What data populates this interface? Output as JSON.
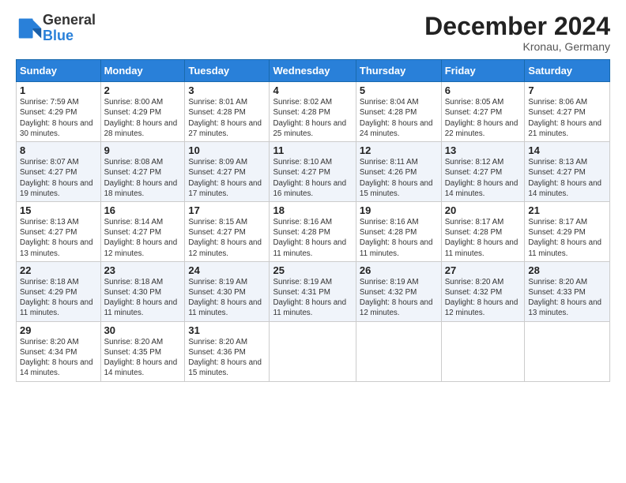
{
  "logo": {
    "general": "General",
    "blue": "Blue"
  },
  "title": {
    "month_year": "December 2024",
    "location": "Kronau, Germany"
  },
  "weekdays": [
    "Sunday",
    "Monday",
    "Tuesday",
    "Wednesday",
    "Thursday",
    "Friday",
    "Saturday"
  ],
  "weeks": [
    [
      {
        "day": "1",
        "sunrise": "7:59 AM",
        "sunset": "4:29 PM",
        "daylight": "8 hours and 30 minutes."
      },
      {
        "day": "2",
        "sunrise": "8:00 AM",
        "sunset": "4:29 PM",
        "daylight": "8 hours and 28 minutes."
      },
      {
        "day": "3",
        "sunrise": "8:01 AM",
        "sunset": "4:28 PM",
        "daylight": "8 hours and 27 minutes."
      },
      {
        "day": "4",
        "sunrise": "8:02 AM",
        "sunset": "4:28 PM",
        "daylight": "8 hours and 25 minutes."
      },
      {
        "day": "5",
        "sunrise": "8:04 AM",
        "sunset": "4:28 PM",
        "daylight": "8 hours and 24 minutes."
      },
      {
        "day": "6",
        "sunrise": "8:05 AM",
        "sunset": "4:27 PM",
        "daylight": "8 hours and 22 minutes."
      },
      {
        "day": "7",
        "sunrise": "8:06 AM",
        "sunset": "4:27 PM",
        "daylight": "8 hours and 21 minutes."
      }
    ],
    [
      {
        "day": "8",
        "sunrise": "8:07 AM",
        "sunset": "4:27 PM",
        "daylight": "8 hours and 19 minutes."
      },
      {
        "day": "9",
        "sunrise": "8:08 AM",
        "sunset": "4:27 PM",
        "daylight": "8 hours and 18 minutes."
      },
      {
        "day": "10",
        "sunrise": "8:09 AM",
        "sunset": "4:27 PM",
        "daylight": "8 hours and 17 minutes."
      },
      {
        "day": "11",
        "sunrise": "8:10 AM",
        "sunset": "4:27 PM",
        "daylight": "8 hours and 16 minutes."
      },
      {
        "day": "12",
        "sunrise": "8:11 AM",
        "sunset": "4:26 PM",
        "daylight": "8 hours and 15 minutes."
      },
      {
        "day": "13",
        "sunrise": "8:12 AM",
        "sunset": "4:27 PM",
        "daylight": "8 hours and 14 minutes."
      },
      {
        "day": "14",
        "sunrise": "8:13 AM",
        "sunset": "4:27 PM",
        "daylight": "8 hours and 14 minutes."
      }
    ],
    [
      {
        "day": "15",
        "sunrise": "8:13 AM",
        "sunset": "4:27 PM",
        "daylight": "8 hours and 13 minutes."
      },
      {
        "day": "16",
        "sunrise": "8:14 AM",
        "sunset": "4:27 PM",
        "daylight": "8 hours and 12 minutes."
      },
      {
        "day": "17",
        "sunrise": "8:15 AM",
        "sunset": "4:27 PM",
        "daylight": "8 hours and 12 minutes."
      },
      {
        "day": "18",
        "sunrise": "8:16 AM",
        "sunset": "4:28 PM",
        "daylight": "8 hours and 11 minutes."
      },
      {
        "day": "19",
        "sunrise": "8:16 AM",
        "sunset": "4:28 PM",
        "daylight": "8 hours and 11 minutes."
      },
      {
        "day": "20",
        "sunrise": "8:17 AM",
        "sunset": "4:28 PM",
        "daylight": "8 hours and 11 minutes."
      },
      {
        "day": "21",
        "sunrise": "8:17 AM",
        "sunset": "4:29 PM",
        "daylight": "8 hours and 11 minutes."
      }
    ],
    [
      {
        "day": "22",
        "sunrise": "8:18 AM",
        "sunset": "4:29 PM",
        "daylight": "8 hours and 11 minutes."
      },
      {
        "day": "23",
        "sunrise": "8:18 AM",
        "sunset": "4:30 PM",
        "daylight": "8 hours and 11 minutes."
      },
      {
        "day": "24",
        "sunrise": "8:19 AM",
        "sunset": "4:30 PM",
        "daylight": "8 hours and 11 minutes."
      },
      {
        "day": "25",
        "sunrise": "8:19 AM",
        "sunset": "4:31 PM",
        "daylight": "8 hours and 11 minutes."
      },
      {
        "day": "26",
        "sunrise": "8:19 AM",
        "sunset": "4:32 PM",
        "daylight": "8 hours and 12 minutes."
      },
      {
        "day": "27",
        "sunrise": "8:20 AM",
        "sunset": "4:32 PM",
        "daylight": "8 hours and 12 minutes."
      },
      {
        "day": "28",
        "sunrise": "8:20 AM",
        "sunset": "4:33 PM",
        "daylight": "8 hours and 13 minutes."
      }
    ],
    [
      {
        "day": "29",
        "sunrise": "8:20 AM",
        "sunset": "4:34 PM",
        "daylight": "8 hours and 14 minutes."
      },
      {
        "day": "30",
        "sunrise": "8:20 AM",
        "sunset": "4:35 PM",
        "daylight": "8 hours and 14 minutes."
      },
      {
        "day": "31",
        "sunrise": "8:20 AM",
        "sunset": "4:36 PM",
        "daylight": "8 hours and 15 minutes."
      },
      null,
      null,
      null,
      null
    ]
  ],
  "labels": {
    "sunrise": "Sunrise:",
    "sunset": "Sunset:",
    "daylight": "Daylight:"
  }
}
